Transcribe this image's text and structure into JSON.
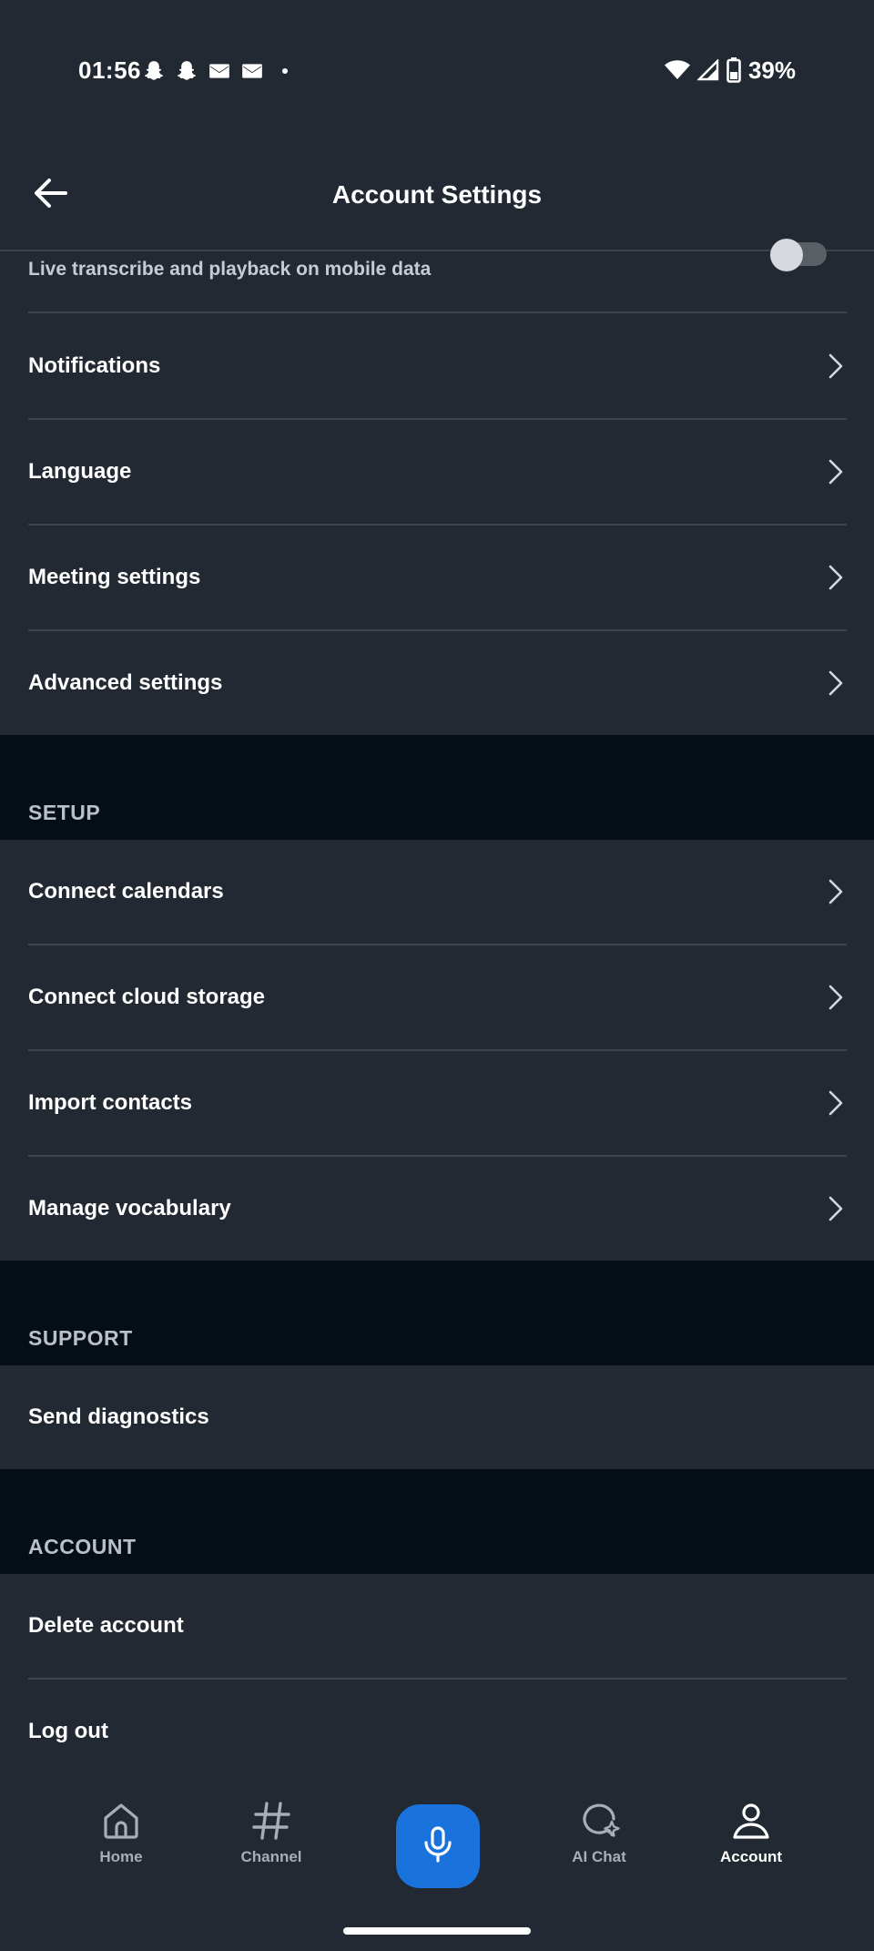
{
  "status_bar": {
    "time": "01:56",
    "battery_percent": "39%",
    "icons_left": [
      "snapchat-icon",
      "snapchat-icon",
      "gmail-icon",
      "gmail-icon",
      "more-dot"
    ],
    "icons_right": [
      "wifi-icon",
      "cell-signal-icon",
      "battery-icon"
    ]
  },
  "header": {
    "title": "Account Settings",
    "back_icon": "arrow-left-icon"
  },
  "partial_row": {
    "subtitle": "Live transcribe and playback on mobile data",
    "toggle_on": false
  },
  "general_items": [
    {
      "label": "Notifications"
    },
    {
      "label": "Language"
    },
    {
      "label": "Meeting settings"
    },
    {
      "label": "Advanced settings"
    }
  ],
  "sections": {
    "setup": {
      "title": "SETUP",
      "items": [
        {
          "label": "Connect calendars"
        },
        {
          "label": "Connect cloud storage"
        },
        {
          "label": "Import contacts"
        },
        {
          "label": "Manage vocabulary"
        }
      ]
    },
    "support": {
      "title": "SUPPORT",
      "items": [
        {
          "label": "Send diagnostics"
        }
      ]
    },
    "account": {
      "title": "ACCOUNT",
      "items": [
        {
          "label": "Delete account"
        },
        {
          "label": "Log out"
        }
      ]
    }
  },
  "bottom_nav": {
    "items": [
      {
        "label": "Home",
        "icon": "home-icon",
        "active": false
      },
      {
        "label": "Channel",
        "icon": "hashtag-icon",
        "active": false
      },
      {
        "label": "",
        "icon": "microphone-icon",
        "active": false
      },
      {
        "label": "AI Chat",
        "icon": "ai-chat-icon",
        "active": false
      },
      {
        "label": "Account",
        "icon": "person-icon",
        "active": true
      }
    ]
  },
  "colors": {
    "background": "#232933",
    "section_background": "#050d17",
    "accent": "#1a72dd",
    "divider": "#3c4450"
  }
}
